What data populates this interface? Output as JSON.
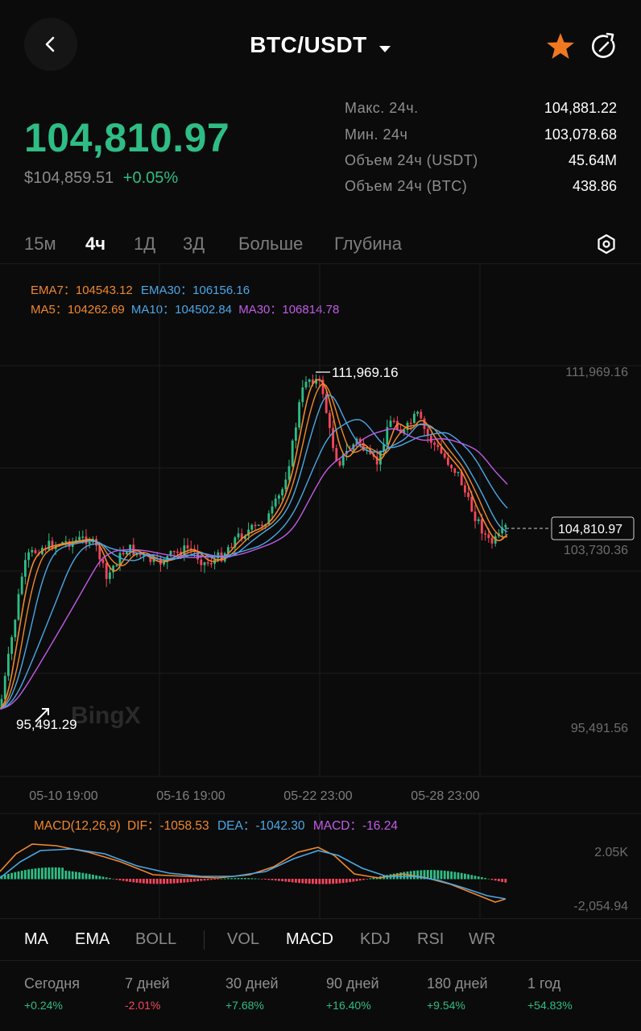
{
  "header": {
    "title": "BTC/USDT"
  },
  "price": {
    "last": "104,810.97",
    "fiat": "$104,859.51",
    "change": "+0.05%"
  },
  "stats": [
    {
      "label": "Макс. 24ч.",
      "value": "104,881.22"
    },
    {
      "label": "Мин. 24ч",
      "value": "103,078.68"
    },
    {
      "label": "Объем 24ч (USDT)",
      "value": "45.64M"
    },
    {
      "label": "Объем 24ч (BTC)",
      "value": "438.86"
    }
  ],
  "timeframes": [
    {
      "label": "15м",
      "active": false
    },
    {
      "label": "4ч",
      "active": true
    },
    {
      "label": "1Д",
      "active": false
    },
    {
      "label": "3Д",
      "active": false
    },
    {
      "label": "Больше",
      "active": false
    },
    {
      "label": "Глубина",
      "active": false
    }
  ],
  "legend": {
    "ema7_label": "EMA7：",
    "ema7_value": "104543.12",
    "ema30_label": "EMA30：",
    "ema30_value": "106156.16",
    "ma5_label": "MA5：",
    "ma5_value": "104262.69",
    "ma10_label": "MA10：",
    "ma10_value": "104502.84",
    "ma30_label": "MA30：",
    "ma30_value": "106814.78"
  },
  "chart": {
    "high_label": "111,969.16",
    "low_label": "95,491.29",
    "current_label": "104,810.97",
    "axis_top": "111,969.16",
    "axis_mid": "103,730.36",
    "axis_bottom": "95,491.56",
    "watermark": "BingX",
    "x_labels": [
      "05-10 19:00",
      "05-16 19:00",
      "05-22 23:00",
      "05-28 23:00"
    ]
  },
  "macd": {
    "title": "MACD(12,26,9)",
    "dif": "DIF：-1058.53",
    "dea": "DEA：-1042.30",
    "macd": "MACD：-16.24",
    "axis_top": "2.05K",
    "axis_bottom": "-2,054.94"
  },
  "indicator_tabs": [
    "MA",
    "EMA",
    "BOLL",
    "VOL",
    "MACD",
    "KDJ",
    "RSI",
    "WR"
  ],
  "performance": [
    {
      "label": "Сегодня",
      "value": "+0.24%"
    },
    {
      "label": "7 дней",
      "value": "-2.01%"
    },
    {
      "label": "30 дней",
      "value": "+7.68%"
    },
    {
      "label": "90 дней",
      "value": "+16.40%"
    },
    {
      "label": "180 дней",
      "value": "+9.54%"
    },
    {
      "label": "1 год",
      "value": "+54.83%"
    }
  ],
  "colors": {
    "up": "#2ebd85",
    "down": "#f6465d",
    "orange": "#f0882d",
    "blue": "#4aa8e8",
    "purple": "#c15ce6",
    "star": "#f0781e"
  }
}
